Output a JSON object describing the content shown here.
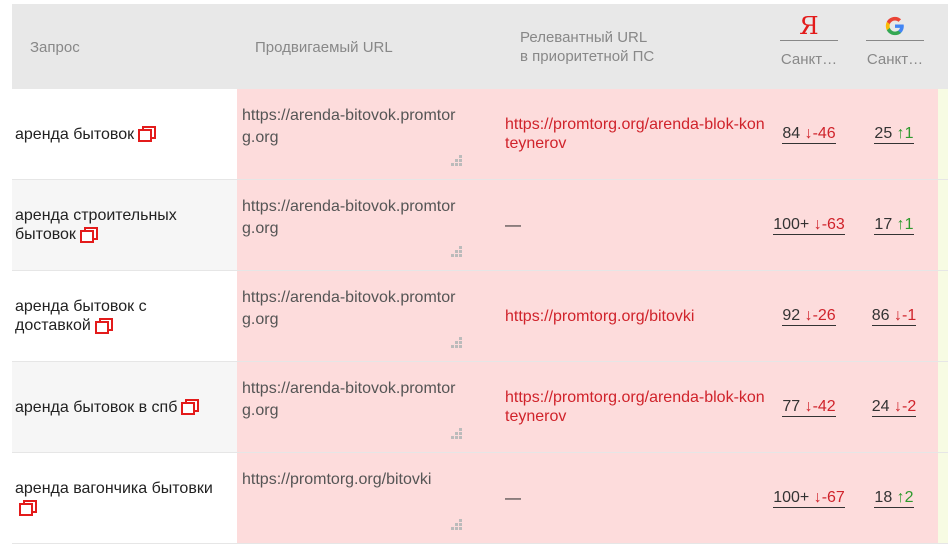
{
  "header": {
    "query_label": "Запрос",
    "promoted_url_label": "Продвигаемый URL",
    "relevant_url_line1": "Релевантный URL",
    "relevant_url_line2": "в приоритетной ПС",
    "yandex_logo": "Я",
    "yandex_region": "Санкт…",
    "google_region": "Санкт…"
  },
  "colors": {
    "accent": "#e31b1b",
    "row_highlight": "#fddcdc",
    "up": "#2e9a2e",
    "down": "#d0232b"
  },
  "rows": [
    {
      "query": "аренда бытовок",
      "promoted_url": "https://arenda-bitovok.promtorg.org",
      "relevant_url": "https://promtorg.org/arenda-blok-konteynerov",
      "yandex_pos": "84",
      "yandex_arrow": "↓",
      "yandex_delta": "-46",
      "google_pos": "25",
      "google_arrow": "↑",
      "google_delta": "1",
      "google_dir": "up",
      "yandex_dir": "down"
    },
    {
      "query": "аренда строительных бытовок",
      "promoted_url": "https://arenda-bitovok.promtorg.org",
      "relevant_url": "—",
      "yandex_pos": "100+",
      "yandex_arrow": "↓",
      "yandex_delta": "-63",
      "google_pos": "17",
      "google_arrow": "↑",
      "google_delta": "1",
      "google_dir": "up",
      "yandex_dir": "down"
    },
    {
      "query": "аренда бытовок с доставкой",
      "promoted_url": "https://arenda-bitovok.promtorg.org",
      "relevant_url": "https://promtorg.org/bitovki",
      "yandex_pos": "92",
      "yandex_arrow": "↓",
      "yandex_delta": "-26",
      "google_pos": "86",
      "google_arrow": "↓",
      "google_delta": "-1",
      "google_dir": "down",
      "yandex_dir": "down"
    },
    {
      "query": "аренда бытовок в спб",
      "promoted_url": "https://arenda-bitovok.promtorg.org",
      "relevant_url": "https://promtorg.org/arenda-blok-konteynerov",
      "yandex_pos": "77",
      "yandex_arrow": "↓",
      "yandex_delta": "-42",
      "google_pos": "24",
      "google_arrow": "↓",
      "google_delta": "-2",
      "google_dir": "down",
      "yandex_dir": "down"
    },
    {
      "query": "аренда вагончика бытовки",
      "promoted_url": "https://promtorg.org/bitovki",
      "relevant_url": "—",
      "yandex_pos": "100+",
      "yandex_arrow": "↓",
      "yandex_delta": "-67",
      "google_pos": "18",
      "google_arrow": "↑",
      "google_delta": "2",
      "google_dir": "up",
      "yandex_dir": "down"
    }
  ]
}
